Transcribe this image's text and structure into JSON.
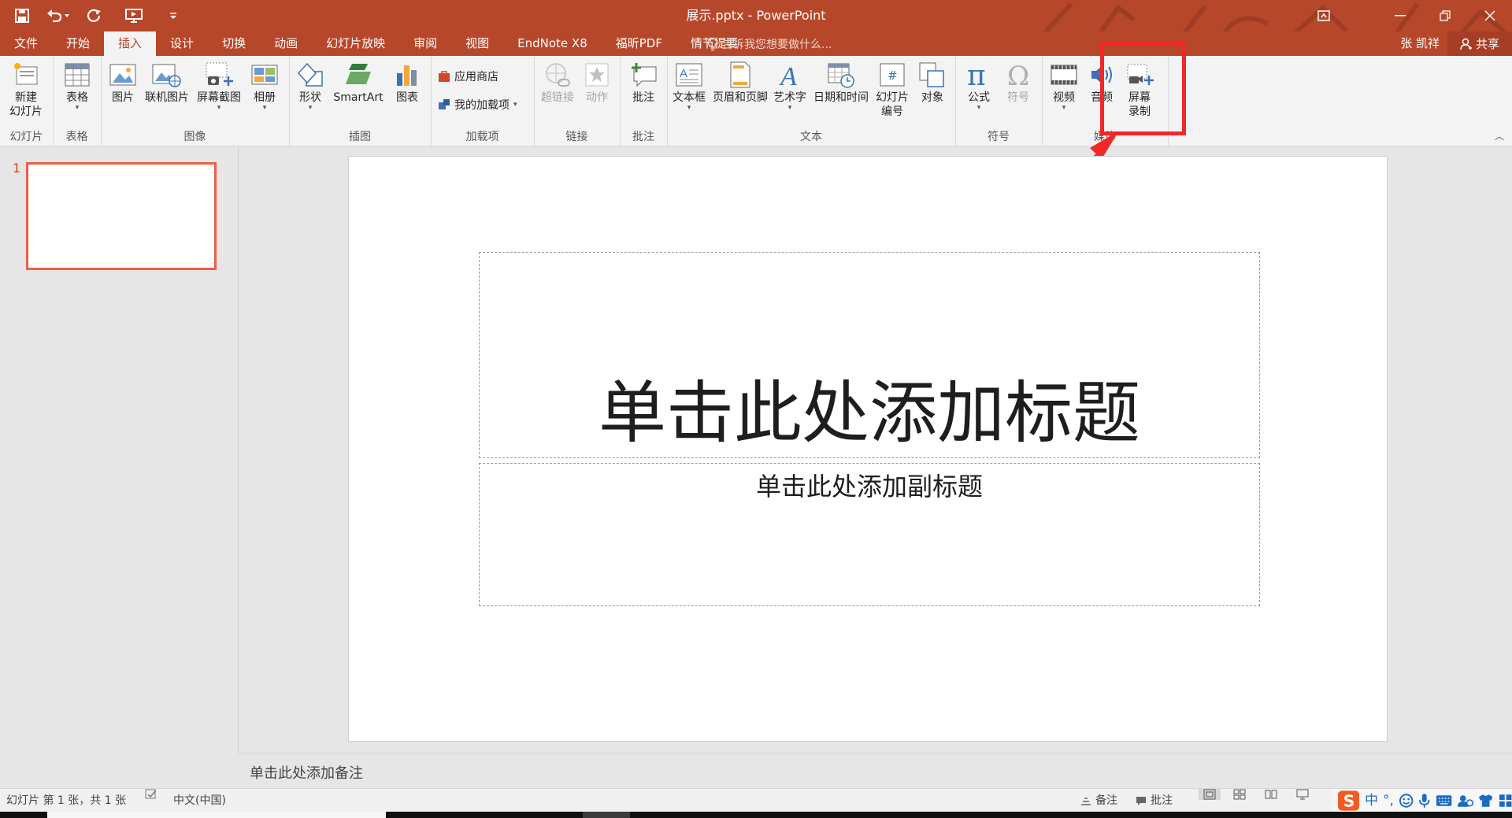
{
  "window": {
    "title": "展示.pptx - PowerPoint",
    "quick_access": [
      "save-icon",
      "undo-icon",
      "redo-icon",
      "present-from-start-icon",
      "customize-qat-icon"
    ],
    "controls": [
      "ribbon-display-options-icon",
      "minimize-icon",
      "restore-icon",
      "close-icon"
    ]
  },
  "tabs": [
    "文件",
    "开始",
    "插入",
    "设计",
    "切换",
    "动画",
    "幻灯片放映",
    "审阅",
    "视图",
    "EndNote X8",
    "福昕PDF",
    "情节提要"
  ],
  "active_tab": "插入",
  "tell_me": "告诉我您想要做什么...",
  "user": "张 凯祥",
  "share": "共享",
  "ribbon": {
    "slides": {
      "label": "幻灯片",
      "new_slide": "新建\n幻灯片"
    },
    "tables": {
      "label": "表格",
      "table": "表格"
    },
    "images": {
      "label": "图像",
      "picture": "图片",
      "online_picture": "联机图片",
      "screenshot": "屏幕截图",
      "album": "相册"
    },
    "illustrations": {
      "label": "插图",
      "shapes": "形状",
      "smartart": "SmartArt",
      "chart": "图表"
    },
    "addins": {
      "label": "加载项",
      "store": "应用商店",
      "my_addins": "我的加载项"
    },
    "links": {
      "label": "链接",
      "hyperlink": "超链接",
      "action": "动作"
    },
    "comments": {
      "label": "批注",
      "comment": "批注"
    },
    "text": {
      "label": "文本",
      "textbox": "文本框",
      "header_footer": "页眉和页脚",
      "wordart": "艺术字",
      "datetime": "日期和时间",
      "slide_number": "幻灯片\n编号",
      "object": "对象"
    },
    "symbols": {
      "label": "符号",
      "equation": "公式",
      "symbol": "符号"
    },
    "media": {
      "label": "媒体",
      "video": "视频",
      "audio": "音频",
      "screen_recording": "屏幕\n录制"
    }
  },
  "annotation": {
    "highlight_color": "#f2272a",
    "target": "屏幕录制"
  },
  "thumbnail": {
    "number": "1"
  },
  "slide": {
    "title_placeholder": "单击此处添加标题",
    "subtitle_placeholder": "单击此处添加副标题"
  },
  "notes_placeholder": "单击此处添加备注",
  "status": {
    "slide_info": "幻灯片 第 1 张，共 1 张",
    "language": "中文(中国)",
    "notes": "备注",
    "comments": "批注"
  },
  "ime": {
    "lang": "中",
    "punct": "°,"
  },
  "colors": {
    "accent": "#b7472a",
    "ribbon_bg": "#f3f3f3",
    "workspace_bg": "#e6e6e6"
  }
}
